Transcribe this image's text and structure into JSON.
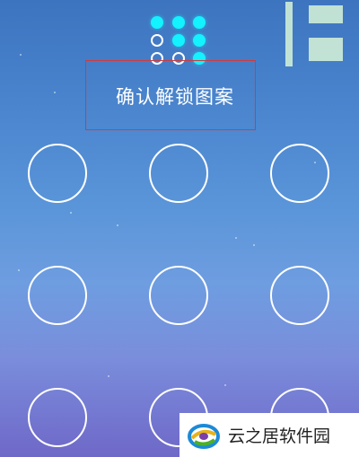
{
  "prompt": {
    "text": "确认解锁图案"
  },
  "preview": {
    "states": [
      true,
      true,
      true,
      false,
      true,
      true,
      false,
      false,
      true
    ],
    "active_color": "#13f2ff"
  },
  "grid": {
    "rows": 3,
    "cols": 3,
    "nodes": [
      "node-1",
      "node-2",
      "node-3",
      "node-4",
      "node-5",
      "node-6",
      "node-7",
      "node-8",
      "node-9"
    ]
  },
  "colors": {
    "accent": "#13f2ff",
    "highlight_box": "#d23a3a",
    "ring": "#ffffff"
  },
  "watermark": {
    "text": "云之居软件园"
  }
}
